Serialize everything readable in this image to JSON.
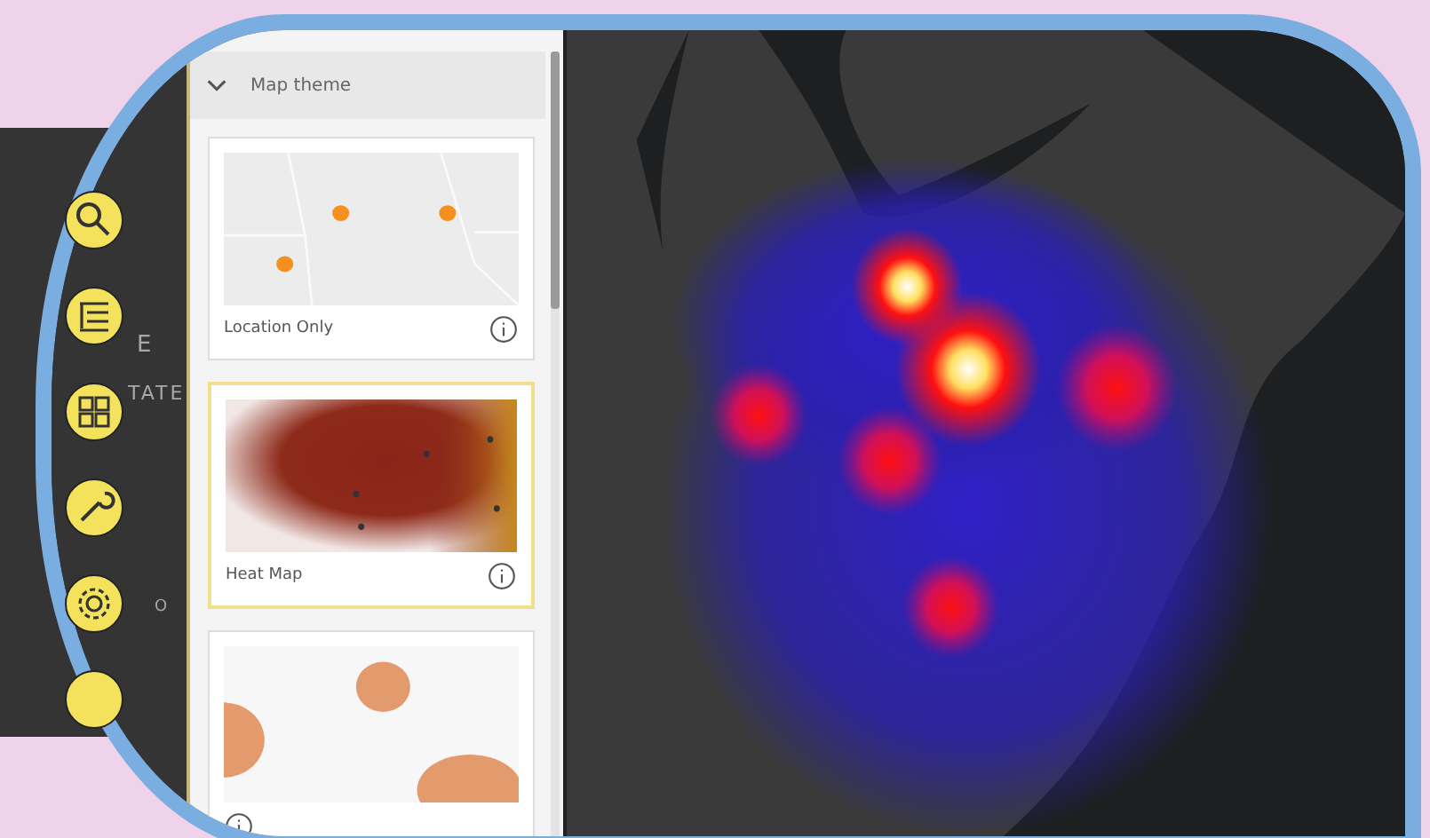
{
  "sidebar": {
    "background_text": [
      "E",
      "TATE",
      "O"
    ]
  },
  "panel": {
    "header": {
      "title": "Map theme",
      "expanded": true
    },
    "themes": [
      {
        "kind": "location",
        "label": "Location Only",
        "selected": false
      },
      {
        "kind": "heat",
        "label": "Heat Map",
        "selected": true
      },
      {
        "kind": "bubble",
        "selected": false
      }
    ]
  }
}
